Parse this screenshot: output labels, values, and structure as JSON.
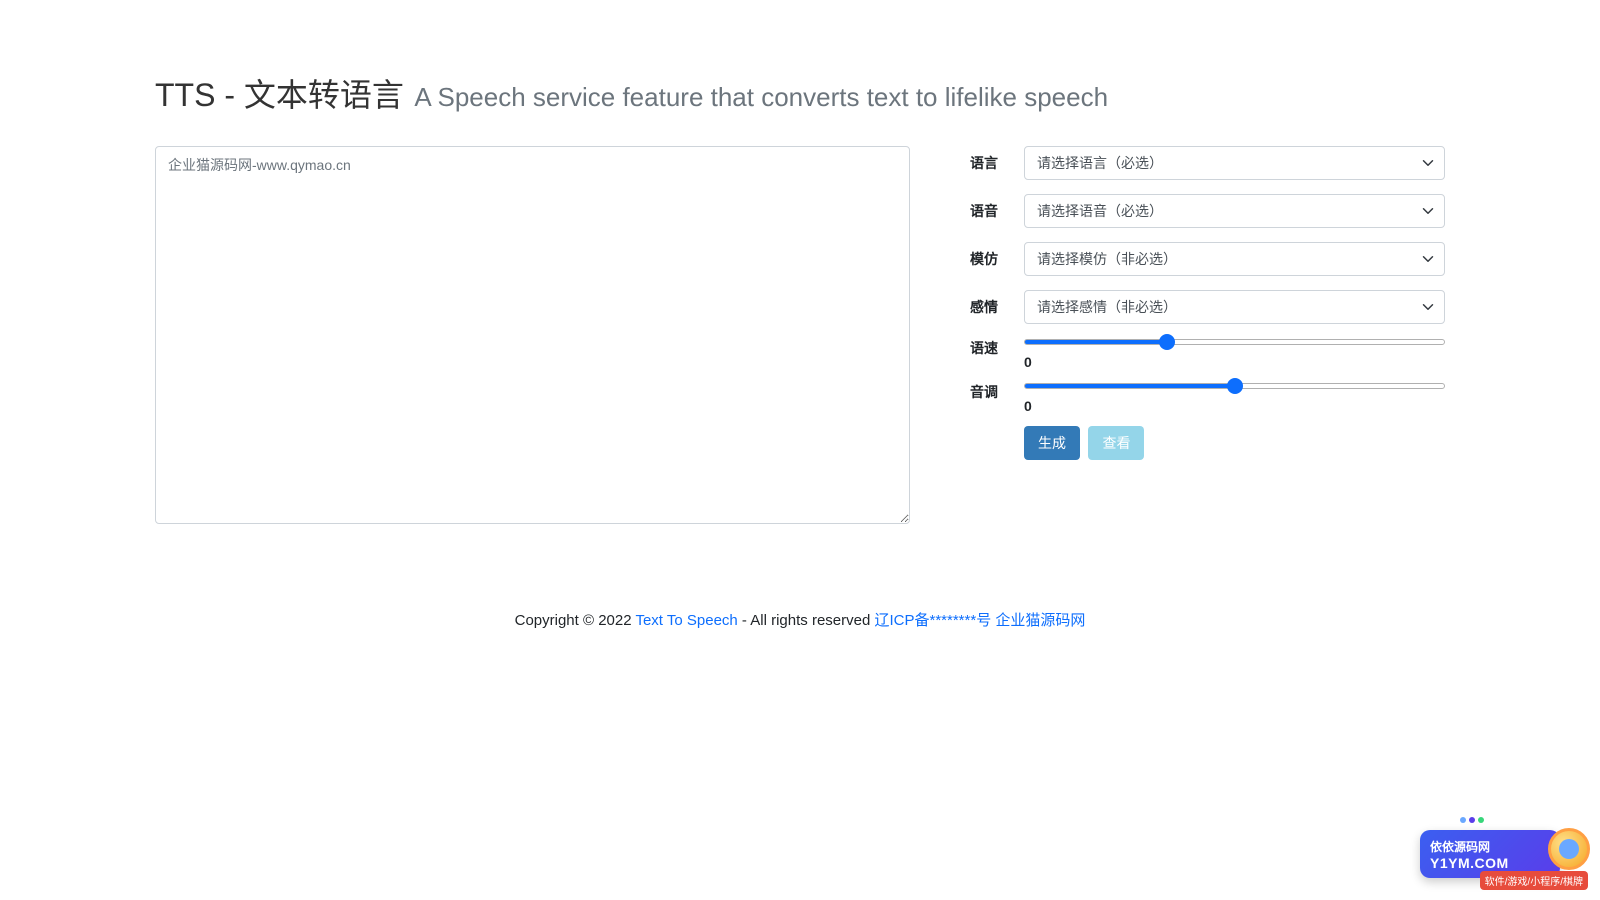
{
  "header": {
    "title": "TTS - 文本转语言",
    "subtitle": "A Speech service feature that converts text to lifelike speech"
  },
  "textarea": {
    "placeholder": "企业猫源码网-www.qymao.cn",
    "value": ""
  },
  "form": {
    "language": {
      "label": "语言",
      "placeholder": "请选择语言（必选）"
    },
    "voice": {
      "label": "语音",
      "placeholder": "请选择语音（必选）"
    },
    "mimic": {
      "label": "模仿",
      "placeholder": "请选择模仿（非必选）"
    },
    "emotion": {
      "label": "感情",
      "placeholder": "请选择感情（非必选）"
    },
    "speed": {
      "label": "语速",
      "value": "0",
      "slider_min": -100,
      "slider_max": 200,
      "slider_val": 0
    },
    "pitch": {
      "label": "音调",
      "value": "0",
      "slider_min": -50,
      "slider_max": 50,
      "slider_val": 0
    }
  },
  "buttons": {
    "generate": "生成",
    "view": "查看"
  },
  "footer": {
    "copyright_prefix": "Copyright © 2022 ",
    "link1": "Text To Speech",
    "middle": " - All rights reserved ",
    "link2": "辽ICP备********号",
    "link3": "企业猫源码网"
  },
  "watermark": {
    "line1": "依依源码网",
    "line2": "Y1YM.COM",
    "strip": "软件/游戏/小程序/棋牌"
  }
}
